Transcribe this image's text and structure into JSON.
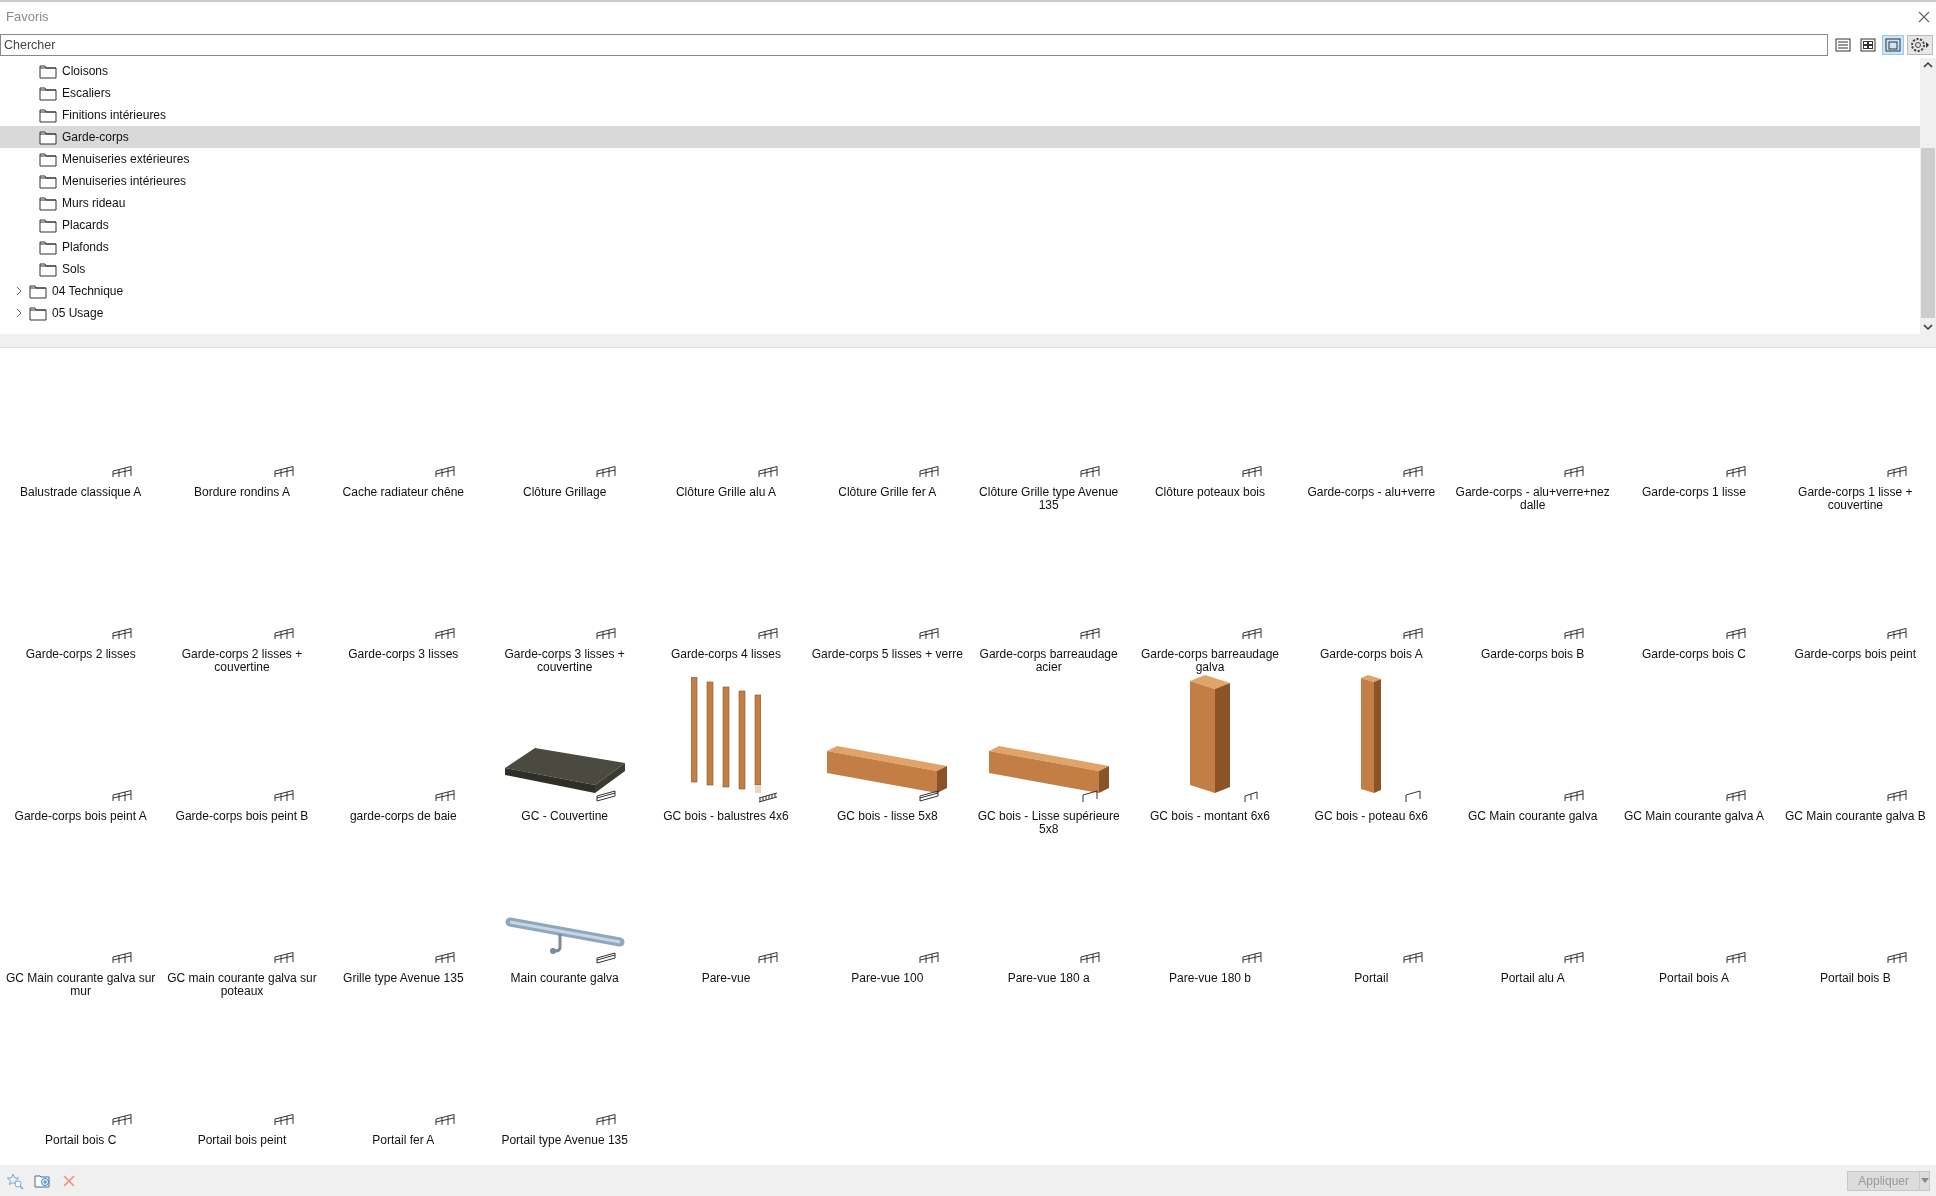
{
  "window": {
    "title": "Favoris"
  },
  "search": {
    "placeholder": "Chercher"
  },
  "view_buttons": [
    {
      "kind": "list",
      "selected": false
    },
    {
      "kind": "grid",
      "selected": false
    },
    {
      "kind": "large",
      "selected": true
    },
    {
      "kind": "settings",
      "selected": false
    }
  ],
  "tree": [
    {
      "children": [
        {
          "label": "Cloisons",
          "selected": false
        },
        {
          "label": "Escaliers",
          "selected": false
        },
        {
          "label": "Finitions intérieures",
          "selected": false
        },
        {
          "label": "Garde-corps",
          "selected": true
        },
        {
          "label": "Menuiseries extérieures",
          "selected": false
        },
        {
          "label": "Menuiseries intérieures",
          "selected": false
        },
        {
          "label": "Murs rideau",
          "selected": false
        },
        {
          "label": "Placards",
          "selected": false
        },
        {
          "label": "Plafonds",
          "selected": false
        },
        {
          "label": "Sols",
          "selected": false
        }
      ]
    },
    {
      "label": "04 Technique",
      "selected": false,
      "expanded": false
    },
    {
      "label": "05 Usage",
      "selected": false,
      "expanded": false
    }
  ],
  "items": [
    {
      "label": "Balustrade classique A",
      "kind": "railing"
    },
    {
      "label": "Bordure rondins A",
      "kind": "railing"
    },
    {
      "label": "Cache radiateur chêne",
      "kind": "railing"
    },
    {
      "label": "Clôture Grillage",
      "kind": "railing"
    },
    {
      "label": "Clôture Grille alu A",
      "kind": "railing"
    },
    {
      "label": "Clôture Grille fer A",
      "kind": "railing"
    },
    {
      "label": "Clôture Grille type Avenue 135",
      "kind": "railing"
    },
    {
      "label": "Clôture poteaux bois",
      "kind": "railing"
    },
    {
      "label": "Garde-corps - alu+verre",
      "kind": "railing"
    },
    {
      "label": "Garde-corps - alu+verre+nez dalle",
      "kind": "railing"
    },
    {
      "label": "Garde-corps 1 lisse",
      "kind": "railing"
    },
    {
      "label": "Garde-corps 1 lisse + couvertine",
      "kind": "railing"
    },
    {
      "label": "Garde-corps 2 lisses",
      "kind": "railing"
    },
    {
      "label": "Garde-corps 2 lisses + couvertine",
      "kind": "railing"
    },
    {
      "label": "Garde-corps 3 lisses",
      "kind": "railing"
    },
    {
      "label": "Garde-corps 3 lisses + couvertine",
      "kind": "railing"
    },
    {
      "label": "Garde-corps 4 lisses",
      "kind": "railing"
    },
    {
      "label": "Garde-corps 5 lisses + verre",
      "kind": "railing"
    },
    {
      "label": "Garde-corps barreaudage acier",
      "kind": "railing"
    },
    {
      "label": "Garde-corps barreaudage galva",
      "kind": "railing"
    },
    {
      "label": "Garde-corps bois A",
      "kind": "railing"
    },
    {
      "label": "Garde-corps bois B",
      "kind": "railing"
    },
    {
      "label": "Garde-corps bois C",
      "kind": "railing"
    },
    {
      "label": "Garde-corps bois peint",
      "kind": "railing"
    },
    {
      "label": "Garde-corps bois peint A",
      "kind": "railing"
    },
    {
      "label": "Garde-corps bois peint B",
      "kind": "railing"
    },
    {
      "label": "garde-corps de baie",
      "kind": "railing"
    },
    {
      "label": "GC - Couvertine",
      "kind": "handrail",
      "preview": {
        "kind": "slab"
      }
    },
    {
      "label": "GC bois - balustres 4x6",
      "kind": "balusters",
      "preview": {
        "kind": "balusters"
      }
    },
    {
      "label": "GC bois - lisse 5x8",
      "kind": "handrail",
      "preview": {
        "kind": "beam"
      }
    },
    {
      "label": "GC bois - Lisse supérieure 5x8",
      "kind": "toprail",
      "preview": {
        "kind": "beam"
      }
    },
    {
      "label": "GC bois - montant 6x6",
      "kind": "posts",
      "preview": {
        "kind": "post"
      }
    },
    {
      "label": "GC bois - poteau 6x6",
      "kind": "toprail",
      "preview": {
        "kind": "thin-post"
      }
    },
    {
      "label": "GC Main courante galva",
      "kind": "railing"
    },
    {
      "label": "GC Main courante galva A",
      "kind": "railing"
    },
    {
      "label": "GC Main courante galva B",
      "kind": "railing"
    },
    {
      "label": "GC Main courante galva sur mur",
      "kind": "railing"
    },
    {
      "label": "GC main courante galva sur poteaux",
      "kind": "railing"
    },
    {
      "label": "Grille type Avenue 135",
      "kind": "railing"
    },
    {
      "label": "Main courante galva",
      "kind": "handrail",
      "preview": {
        "kind": "tube"
      }
    },
    {
      "label": "Pare-vue",
      "kind": "railing"
    },
    {
      "label": "Pare-vue 100",
      "kind": "railing"
    },
    {
      "label": "Pare-vue 180 a",
      "kind": "railing"
    },
    {
      "label": "Pare-vue 180 b",
      "kind": "railing"
    },
    {
      "label": "Portail",
      "kind": "railing"
    },
    {
      "label": "Portail alu A",
      "kind": "railing"
    },
    {
      "label": "Portail bois A",
      "kind": "railing"
    },
    {
      "label": "Portail bois B",
      "kind": "railing"
    },
    {
      "label": "Portail bois C",
      "kind": "railing"
    },
    {
      "label": "Portail bois peint",
      "kind": "railing"
    },
    {
      "label": "Portail fer A",
      "kind": "railing"
    },
    {
      "label": "Portail type Avenue 135",
      "kind": "railing"
    }
  ],
  "footer": {
    "apply_button": {
      "label": "Appliquer",
      "disabled": true
    }
  }
}
